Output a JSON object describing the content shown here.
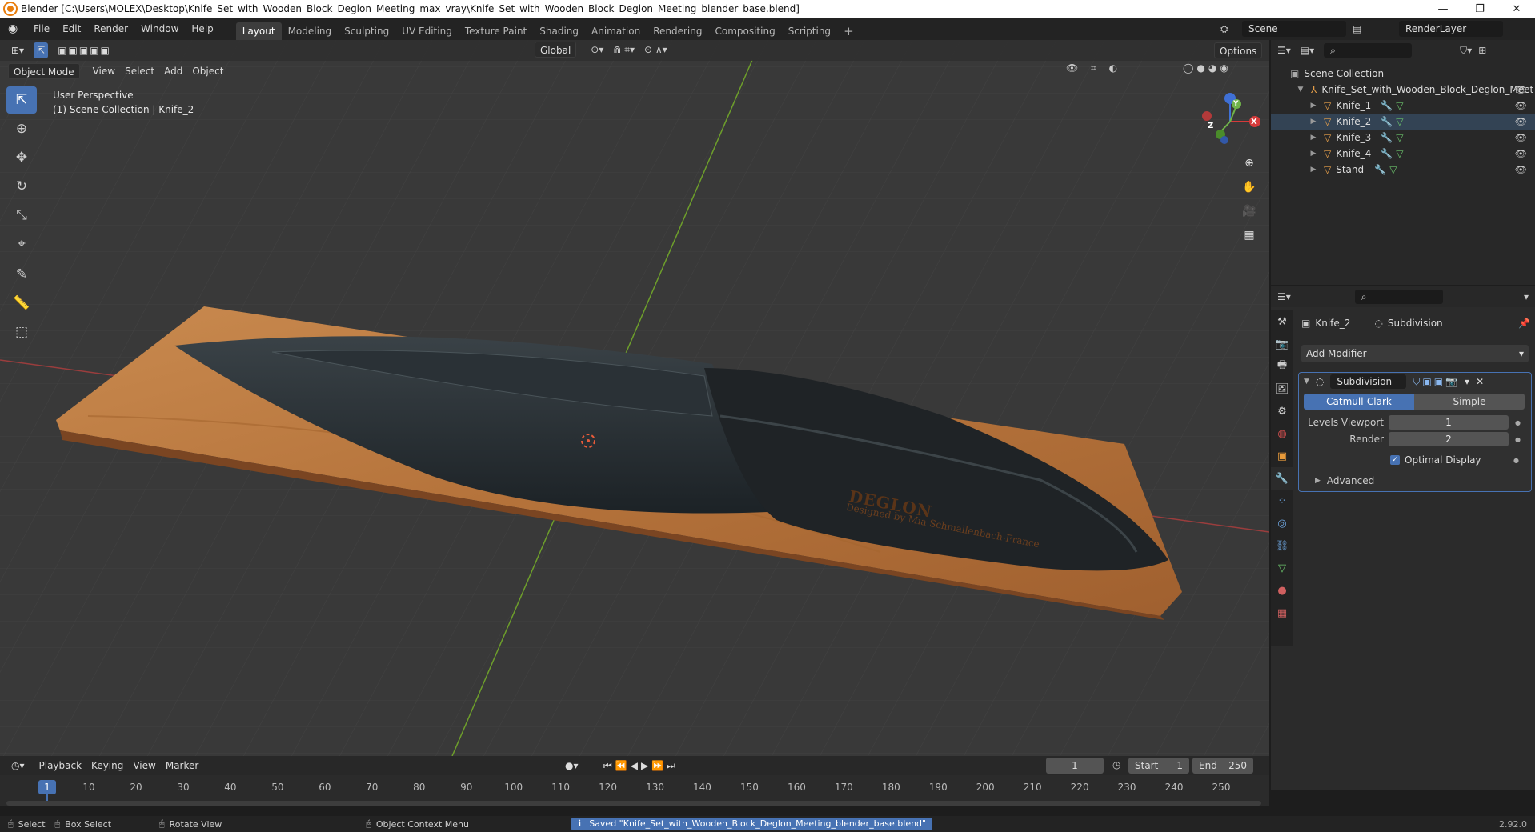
{
  "title": "Blender [C:\\Users\\MOLEX\\Desktop\\Knife_Set_with_Wooden_Block_Deglon_Meeting_max_vray\\Knife_Set_with_Wooden_Block_Deglon_Meeting_blender_base.blend]",
  "menu": [
    "File",
    "Edit",
    "Render",
    "Window",
    "Help"
  ],
  "workspaces": [
    "Layout",
    "Modeling",
    "Sculpting",
    "UV Editing",
    "Texture Paint",
    "Shading",
    "Animation",
    "Rendering",
    "Compositing",
    "Scripting"
  ],
  "active_workspace": "Layout",
  "scene_name": "Scene",
  "render_layer": "RenderLayer",
  "viewport": {
    "mode": "Object Mode",
    "menus": [
      "View",
      "Select",
      "Add",
      "Object"
    ],
    "orientation": "Global",
    "options_label": "Options",
    "perspective_label": "User Perspective",
    "collection_label": "(1) Scene Collection | Knife_2",
    "gizmo_axes": {
      "x": "X",
      "y": "Y",
      "z": "Z"
    },
    "engraving_brand": "DEGLON",
    "engraving_sub": "Designed by Mia Schmallenbach-France"
  },
  "outliner": {
    "root": "Scene Collection",
    "collection": "Knife_Set_with_Wooden_Block_Deglon_Meet",
    "objects": [
      "Knife_1",
      "Knife_2",
      "Knife_3",
      "Knife_4",
      "Stand"
    ]
  },
  "properties": {
    "object_name": "Knife_2",
    "modifier_context": "Subdivision",
    "add_modifier": "Add Modifier",
    "modifier_name": "Subdivision",
    "type_options": [
      "Catmull-Clark",
      "Simple"
    ],
    "selected_type": "Catmull-Clark",
    "levels_viewport_label": "Levels Viewport",
    "levels_viewport": "1",
    "render_label": "Render",
    "render_levels": "2",
    "optimal_display_label": "Optimal Display",
    "optimal_display": true,
    "advanced_label": "Advanced"
  },
  "timeline": {
    "menus": [
      "Playback",
      "Keying",
      "View",
      "Marker"
    ],
    "current_frame": "1",
    "start_label": "Start",
    "start": "1",
    "end_label": "End",
    "end": "250",
    "ruler": [
      "1",
      "10",
      "20",
      "30",
      "40",
      "50",
      "60",
      "70",
      "80",
      "90",
      "100",
      "110",
      "120",
      "130",
      "140",
      "150",
      "160",
      "170",
      "180",
      "190",
      "200",
      "210",
      "220",
      "230",
      "240",
      "250"
    ]
  },
  "statusbar": {
    "select": "Select",
    "box_select": "Box Select",
    "rotate_view": "Rotate View",
    "context_menu": "Object Context Menu",
    "message": "Saved \"Knife_Set_with_Wooden_Block_Deglon_Meeting_blender_base.blend\"",
    "version": "2.92.0"
  },
  "colors": {
    "accent": "#4772b3",
    "viewport_bg": "#393939",
    "wood": "#b9733a",
    "blade": "#2b3236"
  }
}
